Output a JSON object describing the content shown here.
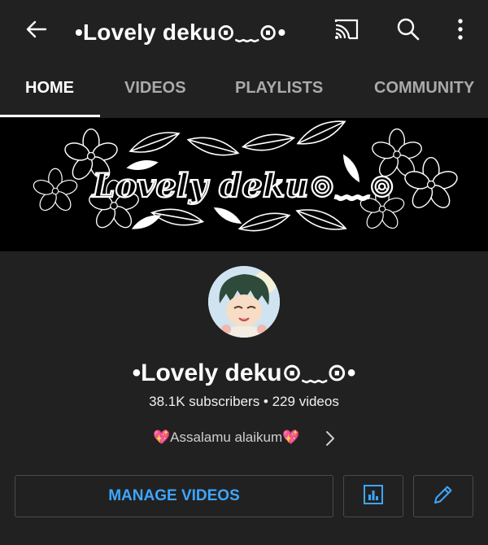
{
  "header": {
    "title": "•Lovely deku⊙﹏⊙•",
    "icons": [
      "back-arrow-icon",
      "cast-icon",
      "search-icon",
      "more-vert-icon"
    ]
  },
  "tabs": [
    {
      "label": "HOME",
      "active": true
    },
    {
      "label": "VIDEOS",
      "active": false
    },
    {
      "label": "PLAYLISTS",
      "active": false
    },
    {
      "label": "COMMUNITY",
      "active": false
    }
  ],
  "banner": {
    "text": "Lovely deku⊙﹏⊙"
  },
  "channel": {
    "name": "•Lovely deku⊙﹏⊙•",
    "stats": "38.1K subscribers • 229 videos",
    "description": "💖Assalamu alaikum💖"
  },
  "actions": {
    "manage_label": "MANAGE VIDEOS",
    "analytics_icon": "analytics-icon",
    "edit_icon": "edit-icon"
  },
  "colors": {
    "background": "#212121",
    "accent": "#3ea6ff",
    "tab_inactive": "#aaaaaa"
  }
}
